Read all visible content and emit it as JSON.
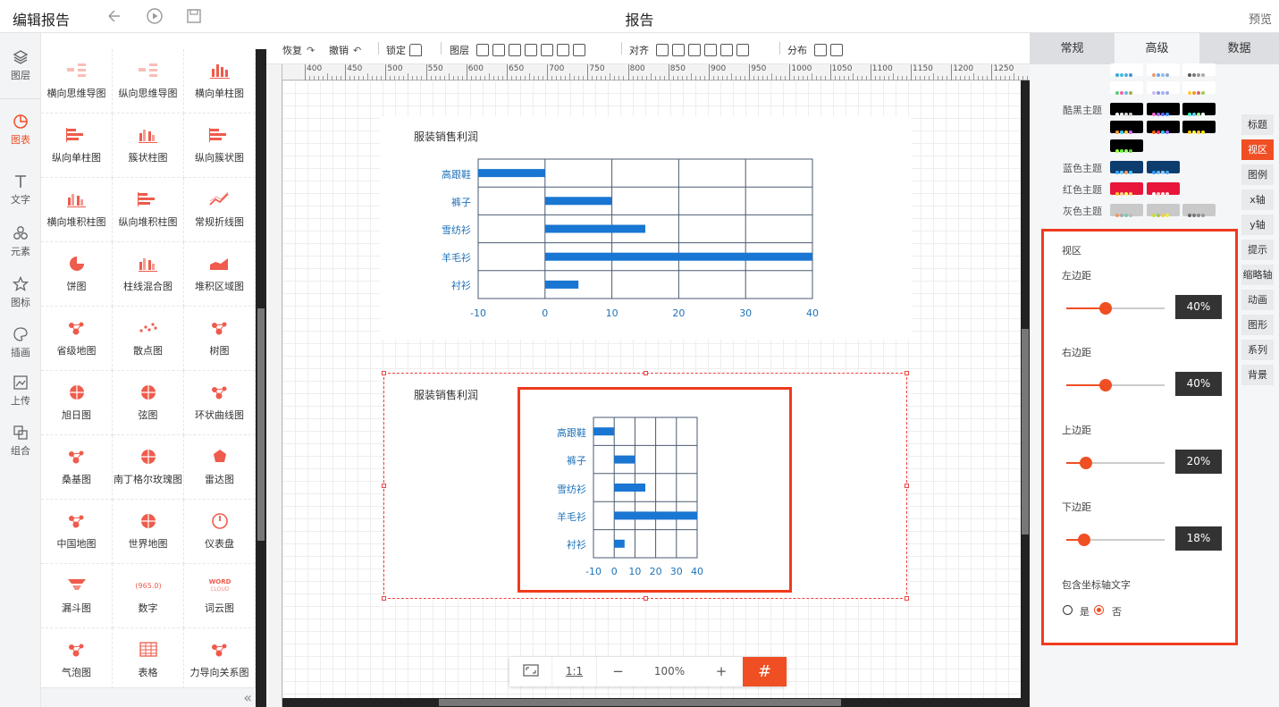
{
  "topbar": {
    "app_title": "编辑报告",
    "doc_title": "报告",
    "preview": "预览"
  },
  "leftnav": [
    {
      "label": "图层",
      "icon": "layers-icon",
      "active": false
    },
    {
      "label": "图表",
      "icon": "chart-icon",
      "active": true
    },
    {
      "label": "文字",
      "icon": "text-icon",
      "active": false
    },
    {
      "label": "元素",
      "icon": "elements-icon",
      "active": false
    },
    {
      "label": "图标",
      "icon": "star-icon",
      "active": false
    },
    {
      "label": "插画",
      "icon": "palette-icon",
      "active": false
    },
    {
      "label": "上传",
      "icon": "upload-icon",
      "active": false
    },
    {
      "label": "组合",
      "icon": "group-icon",
      "active": false
    }
  ],
  "charts": [
    {
      "label": "横向思维导图",
      "icon": "mindmap-h-icon"
    },
    {
      "label": "纵向思维导图",
      "icon": "mindmap-v-icon"
    },
    {
      "label": "横向单柱图",
      "icon": "bar-icon"
    },
    {
      "label": "纵向单柱图",
      "icon": "hbar-icon"
    },
    {
      "label": "簇状柱图",
      "icon": "cluster-bar-icon"
    },
    {
      "label": "纵向簇状图",
      "icon": "cluster-hbar-icon"
    },
    {
      "label": "横向堆积柱图",
      "icon": "stack-bar-icon"
    },
    {
      "label": "纵向堆积柱图",
      "icon": "stack-hbar-icon"
    },
    {
      "label": "常规折线图",
      "icon": "line-icon"
    },
    {
      "label": "饼图",
      "icon": "pie-icon"
    },
    {
      "label": "柱线混合图",
      "icon": "combo-icon"
    },
    {
      "label": "堆积区域图",
      "icon": "area-icon"
    },
    {
      "label": "省级地图",
      "icon": "province-map-icon"
    },
    {
      "label": "散点图",
      "icon": "scatter-icon"
    },
    {
      "label": "树图",
      "icon": "tree-icon"
    },
    {
      "label": "旭日图",
      "icon": "sunburst-icon"
    },
    {
      "label": "弦图",
      "icon": "chord-icon"
    },
    {
      "label": "环状曲线图",
      "icon": "radial-icon"
    },
    {
      "label": "桑基图",
      "icon": "sankey-icon"
    },
    {
      "label": "南丁格尔玫瑰图",
      "icon": "rose-icon"
    },
    {
      "label": "雷达图",
      "icon": "radar-icon"
    },
    {
      "label": "中国地图",
      "icon": "china-map-icon"
    },
    {
      "label": "世界地图",
      "icon": "world-map-icon"
    },
    {
      "label": "仪表盘",
      "icon": "gauge-icon"
    },
    {
      "label": "漏斗图",
      "icon": "funnel-icon"
    },
    {
      "label": "数字",
      "icon": "number-icon",
      "icon_text": "(965.0)"
    },
    {
      "label": "词云图",
      "icon": "wordcloud-icon",
      "icon_text": "WORD CLOUD"
    },
    {
      "label": "气泡图",
      "icon": "bubble-icon"
    },
    {
      "label": "表格",
      "icon": "table-icon"
    },
    {
      "label": "力导向关系图",
      "icon": "force-icon"
    }
  ],
  "toolbar": {
    "redo": "恢复",
    "undo": "撤销",
    "lock": "锁定",
    "layer": "图层",
    "align": "对齐",
    "distribute": "分布"
  },
  "ruler": {
    "ticks": [
      "400",
      "450",
      "500",
      "550",
      "600",
      "650",
      "700",
      "750",
      "800",
      "850",
      "900",
      "950",
      "1000",
      "1050",
      "1100",
      "1150",
      "1200",
      "1250"
    ]
  },
  "zoom": {
    "fit_icon": "fit-screen-icon",
    "actual": "1:1",
    "minus": "−",
    "level": "100%",
    "plus": "+",
    "grid_icon": "grid-icon"
  },
  "chart_data": [
    {
      "type": "bar",
      "orientation": "horizontal",
      "title": "服装销售利润",
      "categories": [
        "高跟鞋",
        "裤子",
        "雪纺衫",
        "羊毛衫",
        "衬衫"
      ],
      "values": [
        -10,
        10,
        15,
        40,
        5
      ],
      "xlim": [
        -10,
        40
      ],
      "xticks": [
        "-10",
        "0",
        "10",
        "20",
        "30",
        "40"
      ],
      "grid": true,
      "color": "#1976d2"
    },
    {
      "type": "bar",
      "orientation": "horizontal",
      "title": "服装销售利润",
      "categories": [
        "高跟鞋",
        "裤子",
        "雪纺衫",
        "羊毛衫",
        "衬衫"
      ],
      "values": [
        -10,
        10,
        15,
        40,
        5
      ],
      "xlim": [
        -10,
        40
      ],
      "xticks": [
        "-10",
        "0",
        "10",
        "20",
        "30",
        "40"
      ],
      "grid": true,
      "color": "#1976d2"
    }
  ],
  "rightpanel": {
    "tabs": [
      "常规",
      "高级",
      "数据"
    ],
    "active_tab": 1,
    "themes": [
      {
        "label": "",
        "rows": [
          [
            [
              "#3ad",
              "#4bd",
              "#5ad",
              "#39d"
            ],
            [
              "#e96",
              "#6ae",
              "#9be",
              "#8ac"
            ],
            [
              "#555",
              "#777",
              "#999",
              "#aaa"
            ]
          ],
          [
            [
              "#5c7",
              "#e6a",
              "#6bd",
              "#aa5"
            ],
            [
              "#cbe",
              "#89d",
              "#aaf",
              "#9ad"
            ],
            [
              "#fc3",
              "#e93",
              "#d66",
              "#9c5"
            ]
          ]
        ],
        "bg": "#fff"
      },
      {
        "label": "酷黑主题",
        "rows": [
          [
            [
              "#fff",
              "#eee",
              "#ddd",
              "#ccc"
            ],
            [
              "#f6c",
              "#96f",
              "#66f",
              "#39f"
            ],
            [
              "#3fc",
              "#6cf",
              "#9f9",
              "#fff"
            ]
          ],
          [
            [
              "#f93",
              "#3cf",
              "#fc3",
              "#c6f"
            ],
            [
              "#f60",
              "#f36",
              "#3cf",
              "#96f"
            ],
            [
              "#fc0",
              "#ff6",
              "#fc3",
              "#fe0"
            ]
          ],
          [
            [
              "#9f3",
              "#6f3",
              "#9f6",
              "#6c3"
            ]
          ]
        ],
        "bg": "#000"
      },
      {
        "label": "蓝色主题",
        "rows": [
          [
            [
              "#3af",
              "#6cf",
              "#f96",
              "#4cf"
            ],
            [
              "#39f",
              "#6bf",
              "#9cf",
              "#4af"
            ]
          ]
        ],
        "bg": "#0c3d6e"
      },
      {
        "label": "红色主题",
        "rows": [
          [
            [
              "#fc3",
              "#fc9",
              "#ff6",
              "#fd6"
            ],
            [
              "#fff",
              "#fcc",
              "#fee",
              "#fdd"
            ]
          ]
        ],
        "bg": "#e8163a"
      },
      {
        "label": "灰色主题",
        "rows": [
          [
            [
              "#e96",
              "#aaa",
              "#7ca",
              "#bbb"
            ],
            [
              "#cd3",
              "#9c6",
              "#fc3",
              "#ee4"
            ],
            [
              "#666",
              "#777",
              "#888",
              "#999"
            ]
          ]
        ],
        "bg": "#c9c9c9"
      }
    ],
    "side_tabs": [
      "标题",
      "视区",
      "图例",
      "x轴",
      "y轴",
      "提示",
      "缩略轴",
      "动画",
      "图形",
      "系列",
      "背景"
    ],
    "active_side_tab": 1,
    "viewport": {
      "title": "视区",
      "sliders": [
        {
          "label": "左边距",
          "value": 40,
          "display": "40%"
        },
        {
          "label": "右边距",
          "value": 40,
          "display": "40%"
        },
        {
          "label": "上边距",
          "value": 20,
          "display": "20%"
        },
        {
          "label": "下边距",
          "value": 18,
          "display": "18%"
        }
      ],
      "include_axis_text": {
        "label": "包含坐标轴文字",
        "yes": "是",
        "no": "否",
        "selected": "否"
      }
    }
  },
  "colors": {
    "accent": "#f04e23",
    "bar": "#1976d2",
    "axis_text": "#1e72b8",
    "highlight": "#f03a1e"
  }
}
